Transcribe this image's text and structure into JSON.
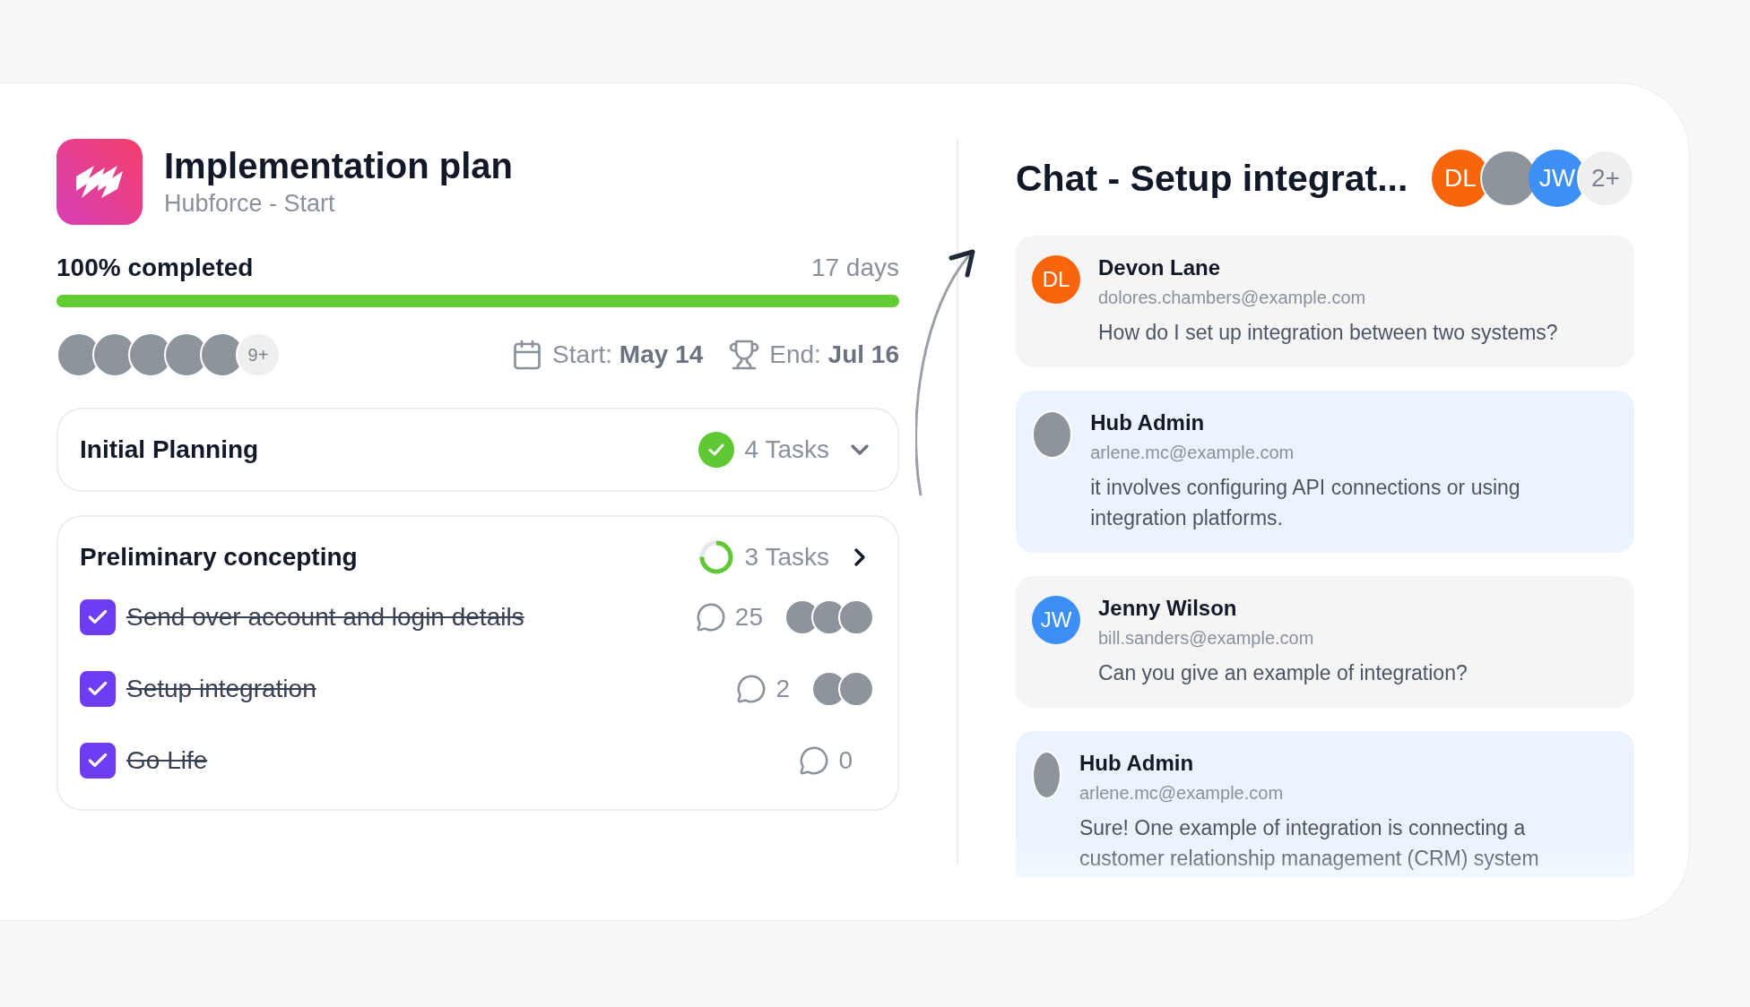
{
  "plan": {
    "title": "Implementation plan",
    "subtitle": "Hubforce - Start"
  },
  "progress": {
    "label": "100% completed",
    "duration": "17 days",
    "level": 1
  },
  "team": {
    "avatars": [
      {
        "kind": "photo"
      },
      {
        "kind": "photo"
      },
      {
        "kind": "photo"
      },
      {
        "kind": "photo"
      },
      {
        "kind": "photo"
      }
    ],
    "more": "9+"
  },
  "dates": {
    "start_label": "Start:",
    "start": "May 14",
    "end_label": "End:",
    "end": "Jul 16"
  },
  "sections": [
    {
      "title": "Initial Planning",
      "count": "4 Tasks",
      "done": true,
      "expanded": false
    },
    {
      "title": "Preliminary concepting",
      "count": "3 Tasks",
      "done": false,
      "level": 0.75,
      "expanded": true,
      "tasks": [
        {
          "text": "Send over account and login details",
          "checked": true,
          "comments": "25",
          "avatars": [
            {
              "kind": "photo"
            },
            {
              "kind": "photo"
            },
            {
              "kind": "photo"
            }
          ]
        },
        {
          "text": "Setup integration",
          "checked": true,
          "comments": "2",
          "avatars": [
            {
              "kind": "photo"
            },
            {
              "kind": "photo"
            }
          ]
        },
        {
          "text": "Go Life",
          "checked": true,
          "comments": "0"
        }
      ]
    }
  ],
  "chat": {
    "title": "Chat - Setup integrat...",
    "participants": [
      {
        "kind": "initials",
        "initials": "DL",
        "color": "#f9650c"
      },
      {
        "kind": "photo"
      },
      {
        "kind": "initials",
        "initials": "JW",
        "color": "#3b8ff5"
      },
      {
        "kind": "more",
        "text": "2+"
      }
    ],
    "messages": [
      {
        "name": "Devon Lane",
        "email": "dolores.chambers@example.com",
        "text": "How do I set up integration between two systems?",
        "color": "#f5f5f6",
        "avatar": {
          "kind": "initials",
          "initials": "DL",
          "color": "#f9650c"
        }
      },
      {
        "name": "Hub Admin",
        "email": "arlene.mc@example.com",
        "text": "it involves configuring API connections or using integration platforms.",
        "color": "#ebf4fe",
        "avatar": {
          "kind": "photo"
        }
      },
      {
        "name": "Jenny Wilson",
        "email": "bill.sanders@example.com",
        "text": "Can you give an example of integration?",
        "color": "#f5f5f6",
        "avatar": {
          "kind": "initials",
          "initials": "JW",
          "color": "#3b8ff5"
        }
      },
      {
        "name": "Hub Admin",
        "email": "arlene.mc@example.com",
        "text": "Sure! One example of integration is connecting a customer relationship management (CRM) system",
        "color": "#ebf4fe",
        "avatar": {
          "kind": "photo"
        }
      }
    ]
  }
}
